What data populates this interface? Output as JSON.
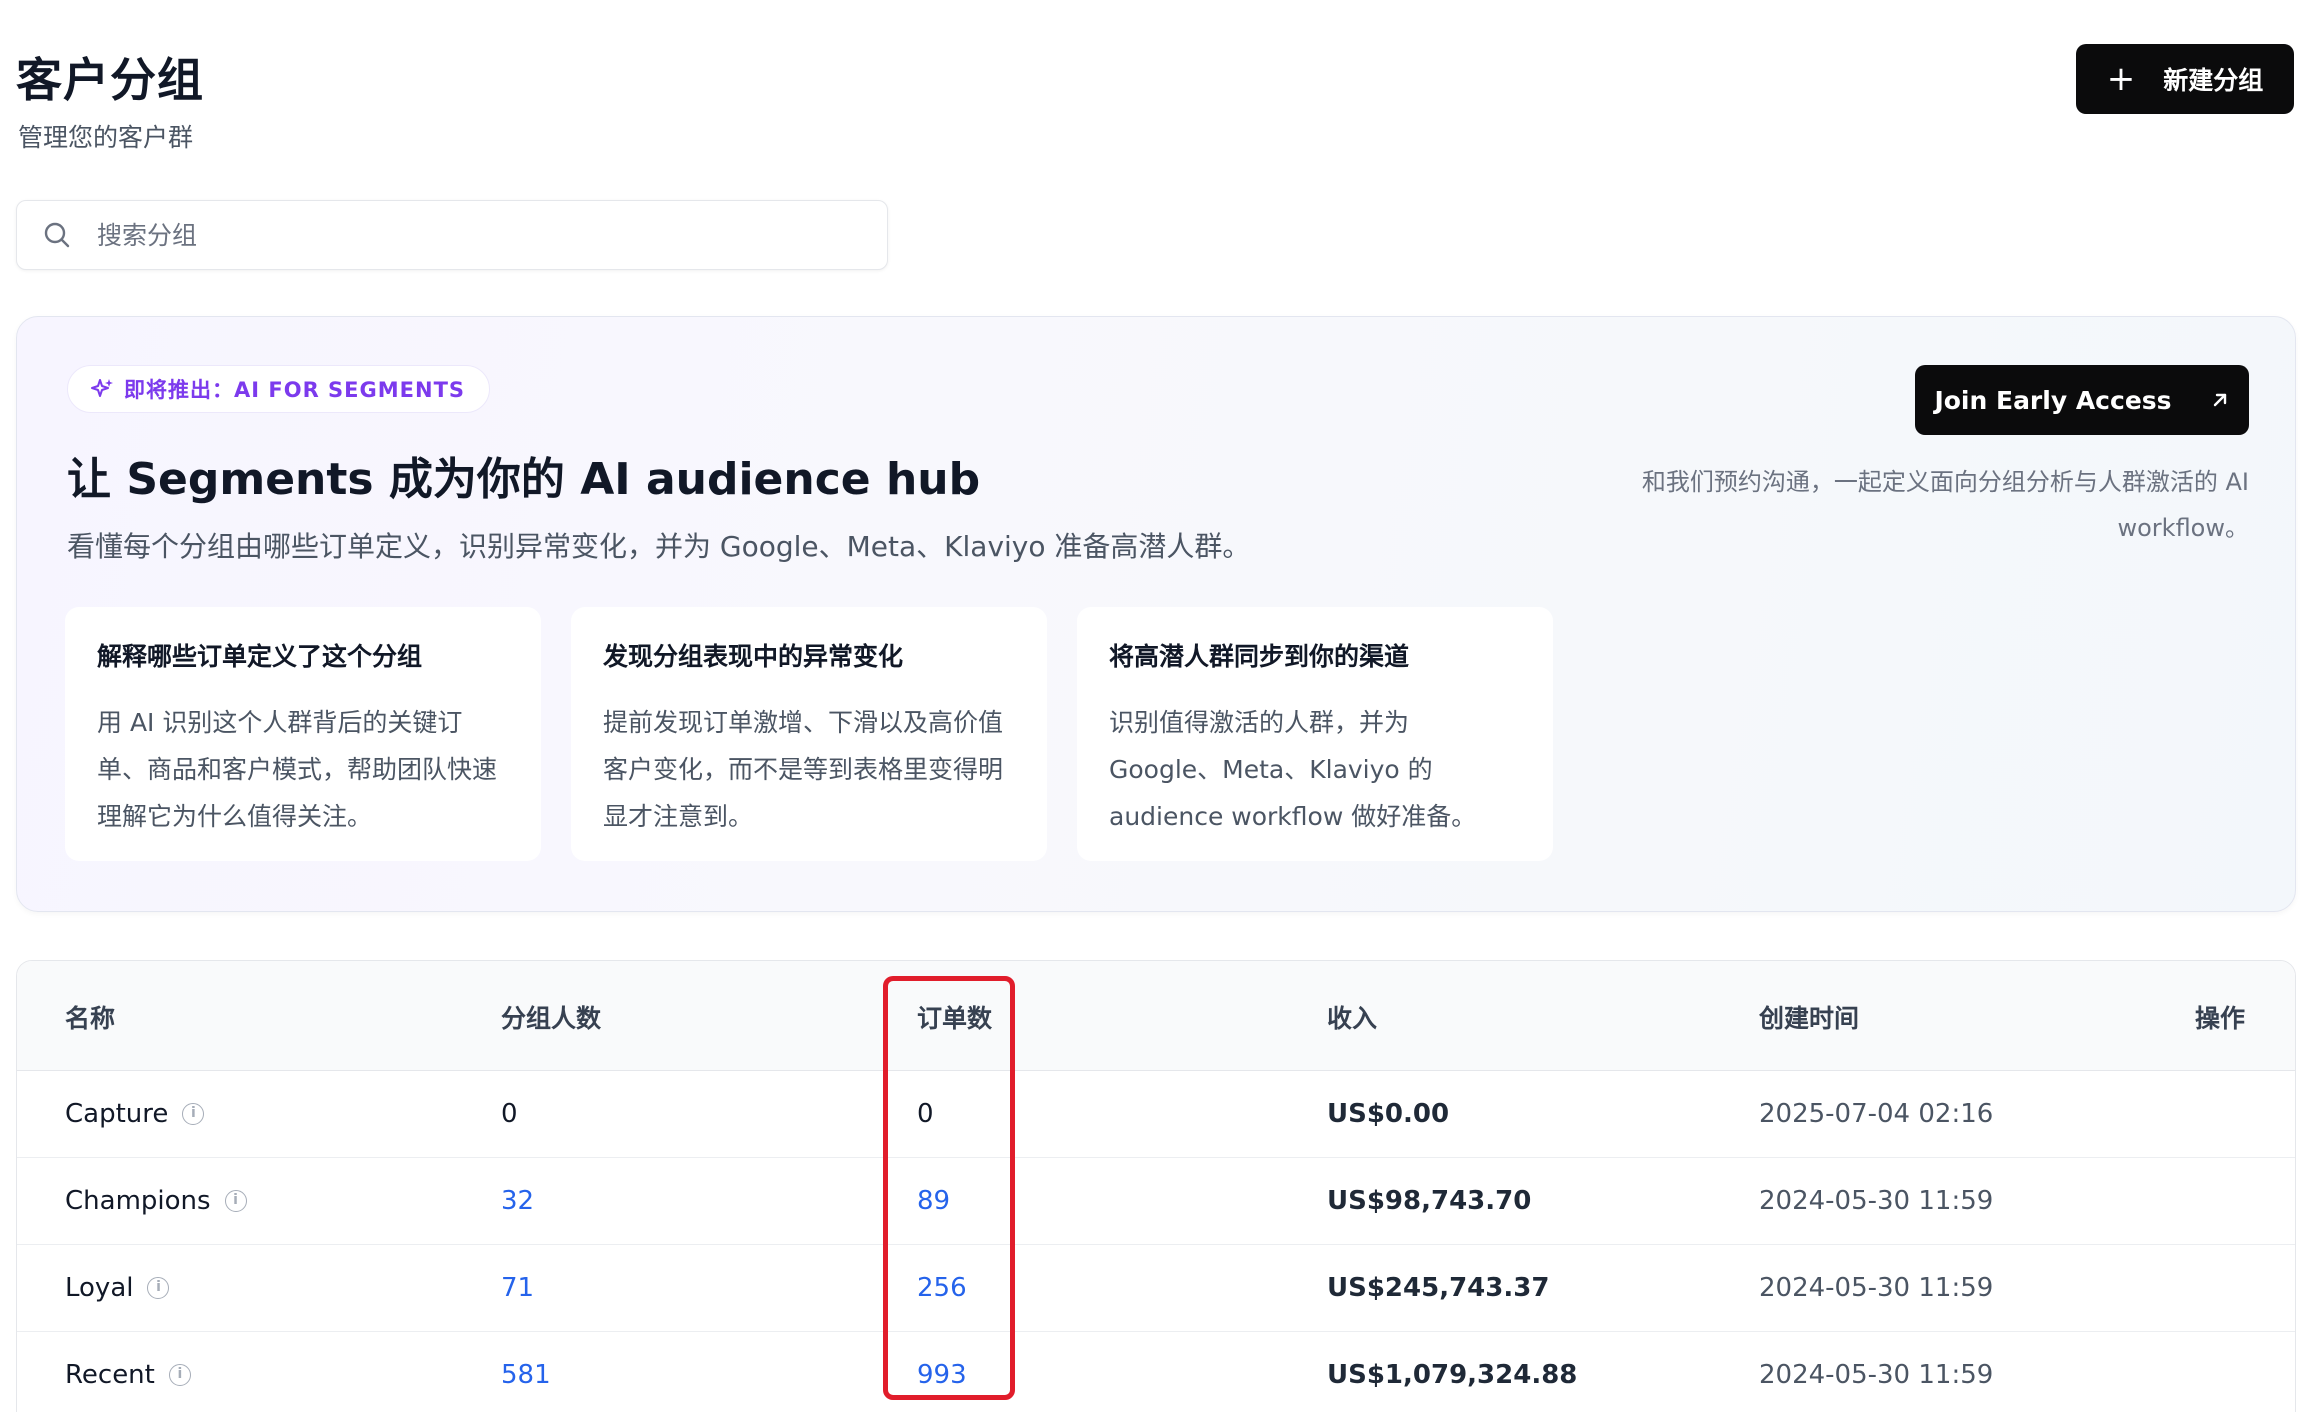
{
  "header": {
    "title": "客户分组",
    "subtitle": "管理您的客户群",
    "new_button_label": "新建分组",
    "new_button_icon": "plus-icon"
  },
  "search": {
    "placeholder": "搜索分组",
    "value": ""
  },
  "promo": {
    "badge": "即将推出：AI FOR SEGMENTS",
    "badge_icon": "sparkle-icon",
    "title": "让 Segments 成为你的 AI audience hub",
    "description": "看懂每个分组由哪些订单定义，识别异常变化，并为 Google、Meta、Klaviyo 准备高潜人群。",
    "join_button": "Join Early Access",
    "join_note": "和我们预约沟通，一起定义面向分组分析与人群激活的 AI workflow。",
    "features": [
      {
        "title": "解释哪些订单定义了这个分组",
        "text": "用 AI 识别这个人群背后的关键订单、商品和客户模式，帮助团队快速理解它为什么值得关注。"
      },
      {
        "title": "发现分组表现中的异常变化",
        "text": "提前发现订单激增、下滑以及高价值客户变化，而不是等到表格里变得明显才注意到。"
      },
      {
        "title": "将高潜人群同步到你的渠道",
        "text": "识别值得激活的人群，并为 Google、Meta、Klaviyo 的 audience workflow 做好准备。"
      }
    ]
  },
  "table": {
    "columns": [
      "名称",
      "分组人数",
      "订单数",
      "收入",
      "创建时间",
      "操作"
    ],
    "rows": [
      {
        "name": "Capture",
        "members": "0",
        "orders": "0",
        "revenue": "US$0.00",
        "created": "2025-07-04 02:16"
      },
      {
        "name": "Champions",
        "members": "32",
        "orders": "89",
        "revenue": "US$98,743.70",
        "created": "2024-05-30 11:59"
      },
      {
        "name": "Loyal",
        "members": "71",
        "orders": "256",
        "revenue": "US$245,743.37",
        "created": "2024-05-30 11:59"
      },
      {
        "name": "Recent",
        "members": "581",
        "orders": "993",
        "revenue": "US$1,079,324.88",
        "created": "2024-05-30 11:59"
      }
    ]
  },
  "colors": {
    "accent_purple": "#7c3aed",
    "link_blue": "#2563eb",
    "highlight_red": "#e11d2b",
    "button_black": "#0b0b0c"
  }
}
